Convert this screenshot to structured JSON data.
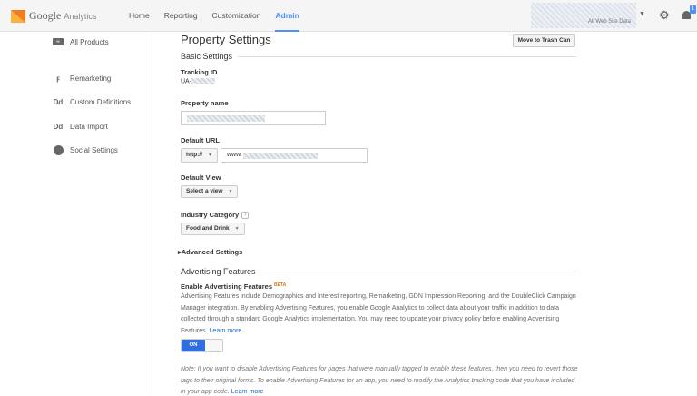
{
  "app": {
    "brand": "Google",
    "product": "Analytics"
  },
  "nav": [
    {
      "label": "Home"
    },
    {
      "label": "Reporting"
    },
    {
      "label": "Customization"
    },
    {
      "label": "Admin"
    }
  ],
  "account": {
    "subtitle": "All Web Site Data",
    "notification_count": "1"
  },
  "sidebar": {
    "items": [
      {
        "label": "All Products",
        "icon": "link-icon"
      },
      {
        "label": "Remarketing",
        "icon": "remarketing-icon"
      },
      {
        "label": "Custom Definitions",
        "icon": "dd-icon"
      },
      {
        "label": "Data Import",
        "icon": "dd-icon"
      },
      {
        "label": "Social Settings",
        "icon": "globe-icon"
      }
    ]
  },
  "main": {
    "title": "Property Settings",
    "trash_label": "Move to Trash Can",
    "basic_settings": "Basic Settings",
    "tracking_id_label": "Tracking ID",
    "tracking_id_prefix": "UA-",
    "property_name_label": "Property name",
    "default_url_label": "Default URL",
    "protocol": "http://",
    "url_prefix": "www.",
    "default_view_label": "Default View",
    "default_view_value": "Select a view",
    "industry_label": "Industry Category",
    "industry_help": "?",
    "industry_value": "Food and Drink",
    "advanced_settings": "Advanced Settings",
    "advertising_features": "Advertising Features",
    "enable_adv_label": "Enable Advertising Features",
    "beta": "BETA",
    "adv_description": "Advertising Features include Demographics and Interest reporting, Remarketing, GDN Impression Reporting, and the DoubleClick Campaign Manager integration. By enabling Advertising Features, you enable Google Analytics to collect data about your traffic in addition to data collected through a standard Google Analytics implementation. You may need to update your privacy policy before enabling Advertising Features.",
    "learn_more": "Learn more",
    "toggle_label": "ON",
    "note": "Note: If you want to disable Advertising Features for pages that were manually tagged to enable these features, then you need to revert those tags to their original forms. To enable Advertising Features for an app, you need to modify the Analytics tracking code that you have included in your app code.",
    "note_learn_more": "Learn more"
  },
  "colors": {
    "accent": "#4d90fe",
    "toggle_on": "#2f6de1",
    "logo": "#f37c20",
    "link": "#1a66c9"
  }
}
